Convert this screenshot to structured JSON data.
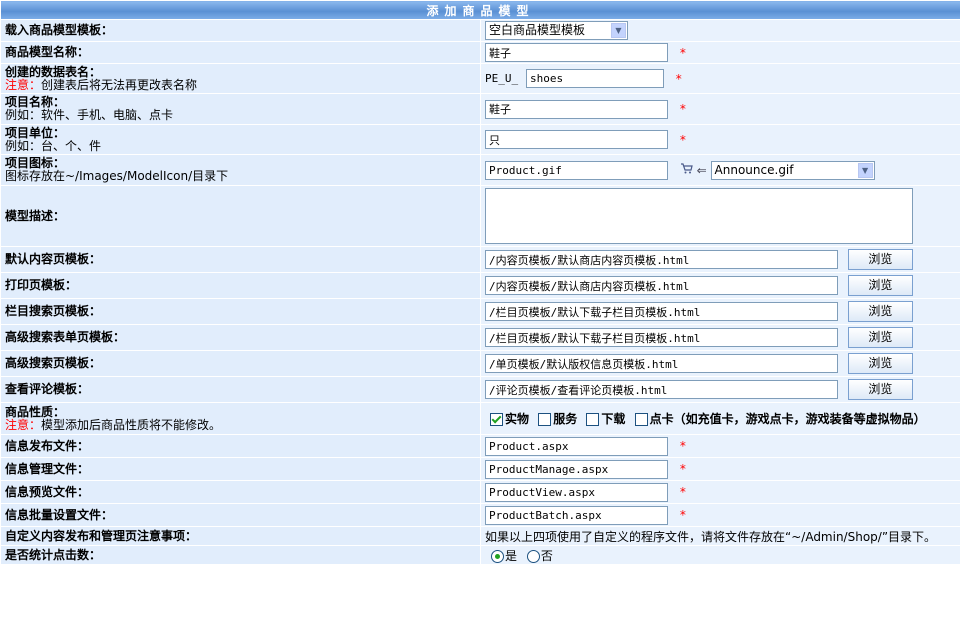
{
  "header": {
    "title": "添加商品模型"
  },
  "rows": {
    "load_template": {
      "label": "载入商品模型模板：",
      "select_value": "空白商品模型模板"
    },
    "model_name": {
      "label": "商品模型名称：",
      "value": "鞋子",
      "required": "*"
    },
    "table_name": {
      "label": "创建的数据表名：",
      "note_warn": "注意：",
      "note": "创建表后将无法再更改表名称",
      "prefix": "PE_U_",
      "value": "shoes",
      "required": "*"
    },
    "item_name": {
      "label": "项目名称：",
      "note": "例如：软件、手机、电脑、点卡",
      "value": "鞋子",
      "required": "*"
    },
    "item_unit": {
      "label": "项目单位：",
      "note": "例如：台、个、件",
      "value": "只",
      "required": "*"
    },
    "item_icon": {
      "label": "项目图标：",
      "note": "图标存放在~/Images/ModelIcon/目录下",
      "value": "Product.gif",
      "arrow": "⇐",
      "select_value": "Announce.gif"
    },
    "description": {
      "label": "模型描述：",
      "value": ""
    },
    "default_content_tpl": {
      "label": "默认内容页模板：",
      "value": "/内容页模板/默认商店内容页模板.html",
      "button": "浏览"
    },
    "print_tpl": {
      "label": "打印页模板：",
      "value": "/内容页模板/默认商店内容页模板.html",
      "button": "浏览"
    },
    "column_search_tpl": {
      "label": "栏目搜索页模板：",
      "value": "/栏目页模板/默认下载子栏目页模板.html",
      "button": "浏览"
    },
    "adv_search_form_tpl": {
      "label": "高级搜索表单页模板：",
      "value": "/栏目页模板/默认下载子栏目页模板.html",
      "button": "浏览"
    },
    "adv_search_tpl": {
      "label": "高级搜索页模板：",
      "value": "/单页模板/默认版权信息页模板.html",
      "button": "浏览"
    },
    "comment_tpl": {
      "label": "查看评论模板：",
      "value": "/评论页模板/查看评论页模板.html",
      "button": "浏览"
    },
    "product_nature": {
      "label": "商品性质：",
      "note_warn": "注意：",
      "note": "模型添加后商品性质将不能修改。",
      "options": [
        "实物",
        "服务",
        "下载",
        "点卡（如充值卡，游戏点卡，游戏装备等虚拟物品）"
      ],
      "checked": [
        true,
        false,
        false,
        false
      ]
    },
    "publish_file": {
      "label": "信息发布文件：",
      "value": "Product.aspx",
      "required": "*"
    },
    "manage_file": {
      "label": "信息管理文件：",
      "value": "ProductManage.aspx",
      "required": "*"
    },
    "preview_file": {
      "label": "信息预览文件：",
      "value": "ProductView.aspx",
      "required": "*"
    },
    "batch_file": {
      "label": "信息批量设置文件：",
      "value": "ProductBatch.aspx",
      "required": "*"
    },
    "custom_note": {
      "label": "自定义内容发布和管理页注意事项：",
      "text": "如果以上四项使用了自定义的程序文件，请将文件存放在“~/Admin/Shop/”目录下。"
    },
    "count_clicks": {
      "label": "是否统计点击数：",
      "yes": "是",
      "no": "否",
      "selected": "yes"
    }
  }
}
